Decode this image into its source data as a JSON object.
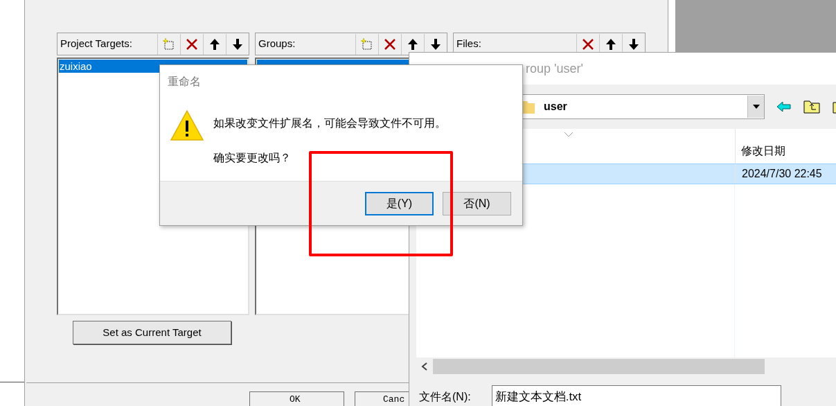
{
  "project_window": {
    "panels": [
      {
        "title": "Project Targets:",
        "tools": [
          {
            "kind": "new"
          },
          {
            "kind": "delete"
          },
          {
            "kind": "up"
          },
          {
            "kind": "down"
          }
        ],
        "items": [
          {
            "label": "zuixiao",
            "selected": true
          }
        ]
      },
      {
        "title": "Groups:",
        "tools": [
          {
            "kind": "new"
          },
          {
            "kind": "delete"
          },
          {
            "kind": "up"
          },
          {
            "kind": "down"
          }
        ],
        "items": [
          {
            "selected": true
          }
        ]
      },
      {
        "title": "Files:",
        "tools": [
          {
            "kind": "delete"
          },
          {
            "kind": "up"
          },
          {
            "kind": "down"
          }
        ]
      }
    ],
    "set_target_button": "Set as Current Target",
    "buttons": [
      "OK",
      "Canc"
    ]
  },
  "add_files_dialog": {
    "title": "roup 'user'",
    "look_in": "user",
    "column": "修改日期",
    "rows": [
      {
        "modified": "2024/7/30 22:45",
        "selected": true
      }
    ],
    "file_name_label": "文件名(N):",
    "file_name": "新建文本文档.txt"
  },
  "rename_dialog": {
    "title": "重命名",
    "message": "如果改变文件扩展名，可能会导致文件不可用。",
    "question": "确实要更改吗？",
    "buttons": [
      {
        "label": "是(Y)",
        "selected": true
      },
      {
        "label": "否(N)",
        "selected": false
      }
    ]
  }
}
